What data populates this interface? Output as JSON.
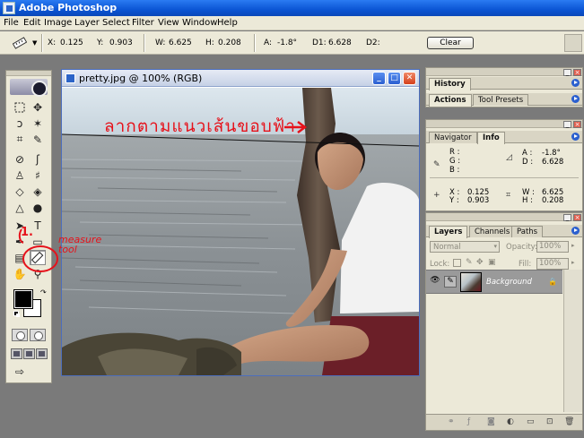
{
  "app": {
    "title": "Adobe Photoshop"
  },
  "menu": [
    "File",
    "Edit",
    "Image",
    "Layer",
    "Select",
    "Filter",
    "View",
    "Window",
    "Help"
  ],
  "options": {
    "x_label": "X:",
    "x": "0.125",
    "y_label": "Y:",
    "y": "0.903",
    "w_label": "W:",
    "w": "6.625",
    "h_label": "H:",
    "h": "0.208",
    "a_label": "A:",
    "a": "-1.8°",
    "d1_label": "D1:",
    "d1": "6.628",
    "d2_label": "D2:",
    "clear": "Clear"
  },
  "document": {
    "title": "pretty.jpg @ 100% (RGB)"
  },
  "panels": {
    "history_tab": "History",
    "actions_tab": "Actions",
    "tool_presets_tab": "Tool Presets",
    "navigator_tab": "Navigator",
    "info_tab": "Info",
    "info": {
      "r": "R :",
      "g": "G :",
      "b": "B :",
      "a_label": "A :",
      "a": "-1.8°",
      "d_label": "D :",
      "d": "6.628",
      "x_label": "X :",
      "x": "0.125",
      "y_label": "Y :",
      "y": "0.903",
      "w_label": "W :",
      "w": "6.625",
      "h_label": "H :",
      "h": "0.208"
    },
    "layers_tab": "Layers",
    "channels_tab": "Channels",
    "paths_tab": "Paths",
    "blend_mode": "Normal",
    "opacity_label": "Opacity:",
    "opacity": "100%",
    "lock_label": "Lock:",
    "fill_label": "Fill:",
    "fill": "100%",
    "layer_name": "Background"
  },
  "annotations": {
    "thai_caption": "ลากตามแนวเส้นขอบฟ้า",
    "number": "1.",
    "measure_tool": "measure\ntool"
  },
  "colors": {
    "accent": "#0b55d4",
    "annotation": "#e6121b"
  }
}
